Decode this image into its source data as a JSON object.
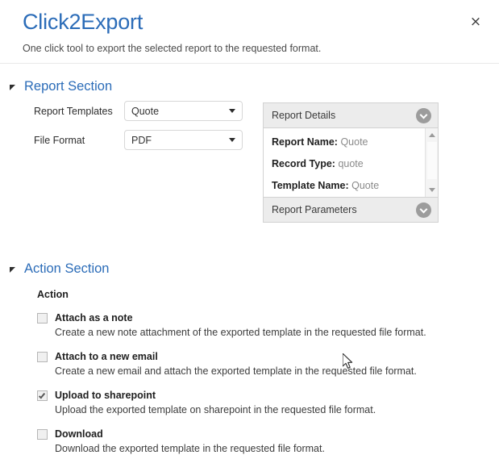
{
  "header": {
    "title": "Click2Export",
    "subtitle": "One click tool to export the selected report to the requested format.",
    "close_label": "×",
    "brand_color": "#2b6cb8"
  },
  "report_section": {
    "title": "Report Section",
    "fields": [
      {
        "label": "Report Templates",
        "value": "Quote"
      },
      {
        "label": "File Format",
        "value": "PDF"
      }
    ],
    "accordion": {
      "details_header": "Report Details",
      "details": [
        {
          "key": "Report Name:",
          "value": "Quote"
        },
        {
          "key": "Record Type:",
          "value": "quote"
        },
        {
          "key": "Template Name:",
          "value": "Quote"
        }
      ],
      "parameters_header": "Report Parameters"
    }
  },
  "action_section": {
    "title": "Action Section",
    "caption": "Action",
    "options": [
      {
        "title": "Attach as a note",
        "description": "Create a new note attachment of the exported template in the requested file format.",
        "checked": false
      },
      {
        "title": "Attach to a new email",
        "description": "Create a new email and attach the exported template in the requested file format.",
        "checked": false
      },
      {
        "title": "Upload to sharepoint",
        "description": "Upload the exported template on sharepoint in the requested file format.",
        "checked": true
      },
      {
        "title": "Download",
        "description": "Download the exported template in the requested file format.",
        "checked": false
      }
    ]
  }
}
